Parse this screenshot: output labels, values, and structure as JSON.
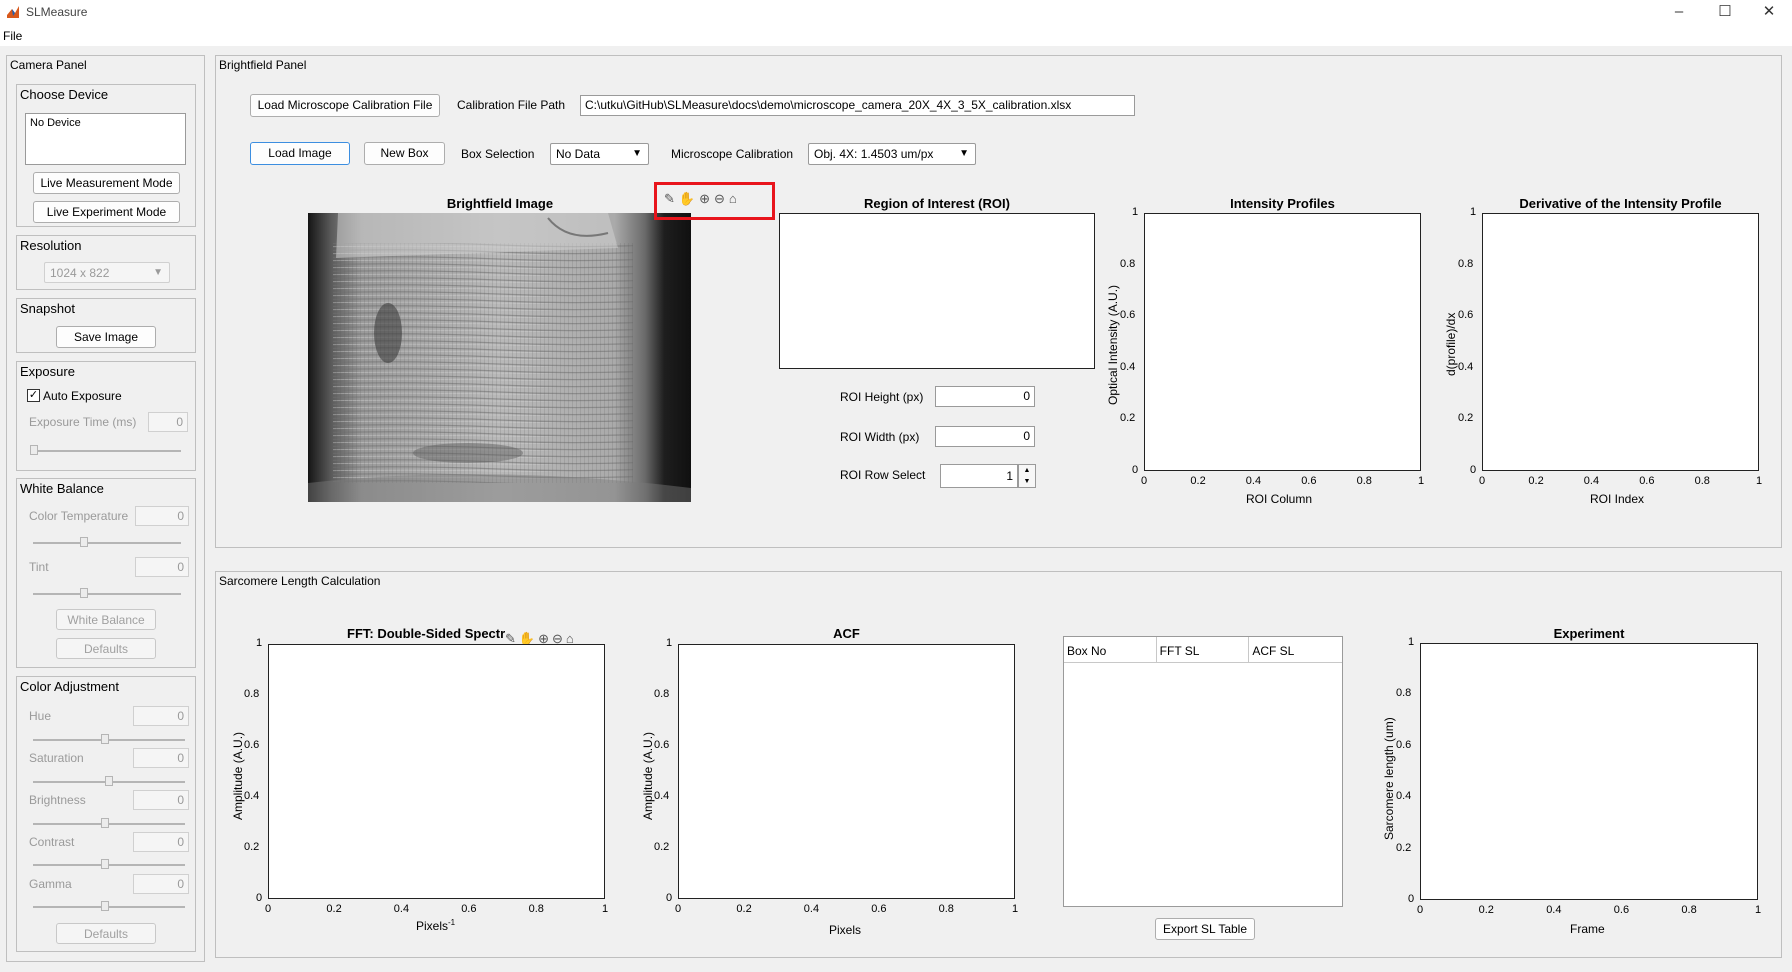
{
  "window": {
    "title": "SLMeasure"
  },
  "menu": {
    "file": "File"
  },
  "camera_panel": {
    "title": "Camera Panel",
    "choose_device": {
      "title": "Choose Device",
      "list_item": "No Device",
      "live_measurement": "Live Measurement Mode",
      "live_experiment": "Live Experiment Mode"
    },
    "resolution": {
      "title": "Resolution",
      "value": "1024 x 822"
    },
    "snapshot": {
      "title": "Snapshot",
      "save": "Save Image"
    },
    "exposure": {
      "title": "Exposure",
      "auto_label": "Auto Exposure",
      "auto_checked": true,
      "time_label": "Exposure Time (ms)",
      "time_value": "0"
    },
    "white_balance": {
      "title": "White Balance",
      "color_temp_label": "Color Temperature",
      "color_temp_value": "0",
      "tint_label": "Tint",
      "tint_value": "0",
      "wb_button": "White Balance",
      "defaults": "Defaults"
    },
    "color_adjustment": {
      "title": "Color Adjustment",
      "hue_label": "Hue",
      "hue_value": "0",
      "saturation_label": "Saturation",
      "saturation_value": "0",
      "brightness_label": "Brightness",
      "brightness_value": "0",
      "contrast_label": "Contrast",
      "contrast_value": "0",
      "gamma_label": "Gamma",
      "gamma_value": "0",
      "defaults": "Defaults"
    }
  },
  "brightfield": {
    "title": "Brightfield Panel",
    "load_calibration": "Load Microscope Calibration File",
    "calib_path_label": "Calibration File Path",
    "calib_path_value": "C:\\utku\\GitHub\\SLMeasure\\docs\\demo\\microscope_camera_20X_4X_3_5X_calibration.xlsx",
    "load_image": "Load Image",
    "new_box": "New Box",
    "box_selection_label": "Box Selection",
    "box_selection_value": "No Data",
    "microscope_calibration_label": "Microscope Calibration",
    "microscope_calibration_value": "Obj. 4X: 1.4503 um/px",
    "image_title": "Brightfield Image",
    "roi_title": "Region of Interest (ROI)",
    "roi_height_label": "ROI Height (px)",
    "roi_height_value": "0",
    "roi_width_label": "ROI Width (px)",
    "roi_width_value": "0",
    "roi_row_label": "ROI Row Select",
    "roi_row_value": "1",
    "intensity": {
      "title": "Intensity Profiles",
      "xlabel": "ROI Column",
      "ylabel": "Optical Intensity (A.U.)"
    },
    "derivative": {
      "title": "Derivative of the Intensity Profile",
      "xlabel": "ROI Index",
      "ylabel": "d(profile)/dx"
    }
  },
  "sarcomere": {
    "title": "Sarcomere Length Calculation",
    "fft": {
      "title": "FFT: Double-Sided Spectr",
      "xlabel": "Pixels",
      "xlabel_sup": "-1",
      "ylabel": "Amplitude (A.U.)"
    },
    "acf": {
      "title": "ACF",
      "xlabel": "Pixels",
      "ylabel": "Amplitude (A.U.)"
    },
    "table": {
      "columns": [
        "Box No",
        "FFT SL",
        "ACF SL"
      ]
    },
    "export": "Export SL Table",
    "experiment": {
      "title": "Experiment",
      "xlabel": "Frame",
      "ylabel": "Sarcomere length (um)"
    }
  },
  "axes_ticks": {
    "x": [
      "0",
      "0.2",
      "0.4",
      "0.6",
      "0.8",
      "1"
    ],
    "y": [
      "0",
      "0.2",
      "0.4",
      "0.6",
      "0.8",
      "1"
    ]
  },
  "colors": {
    "highlight": "#e8151c",
    "focus": "#3c8ee0"
  }
}
